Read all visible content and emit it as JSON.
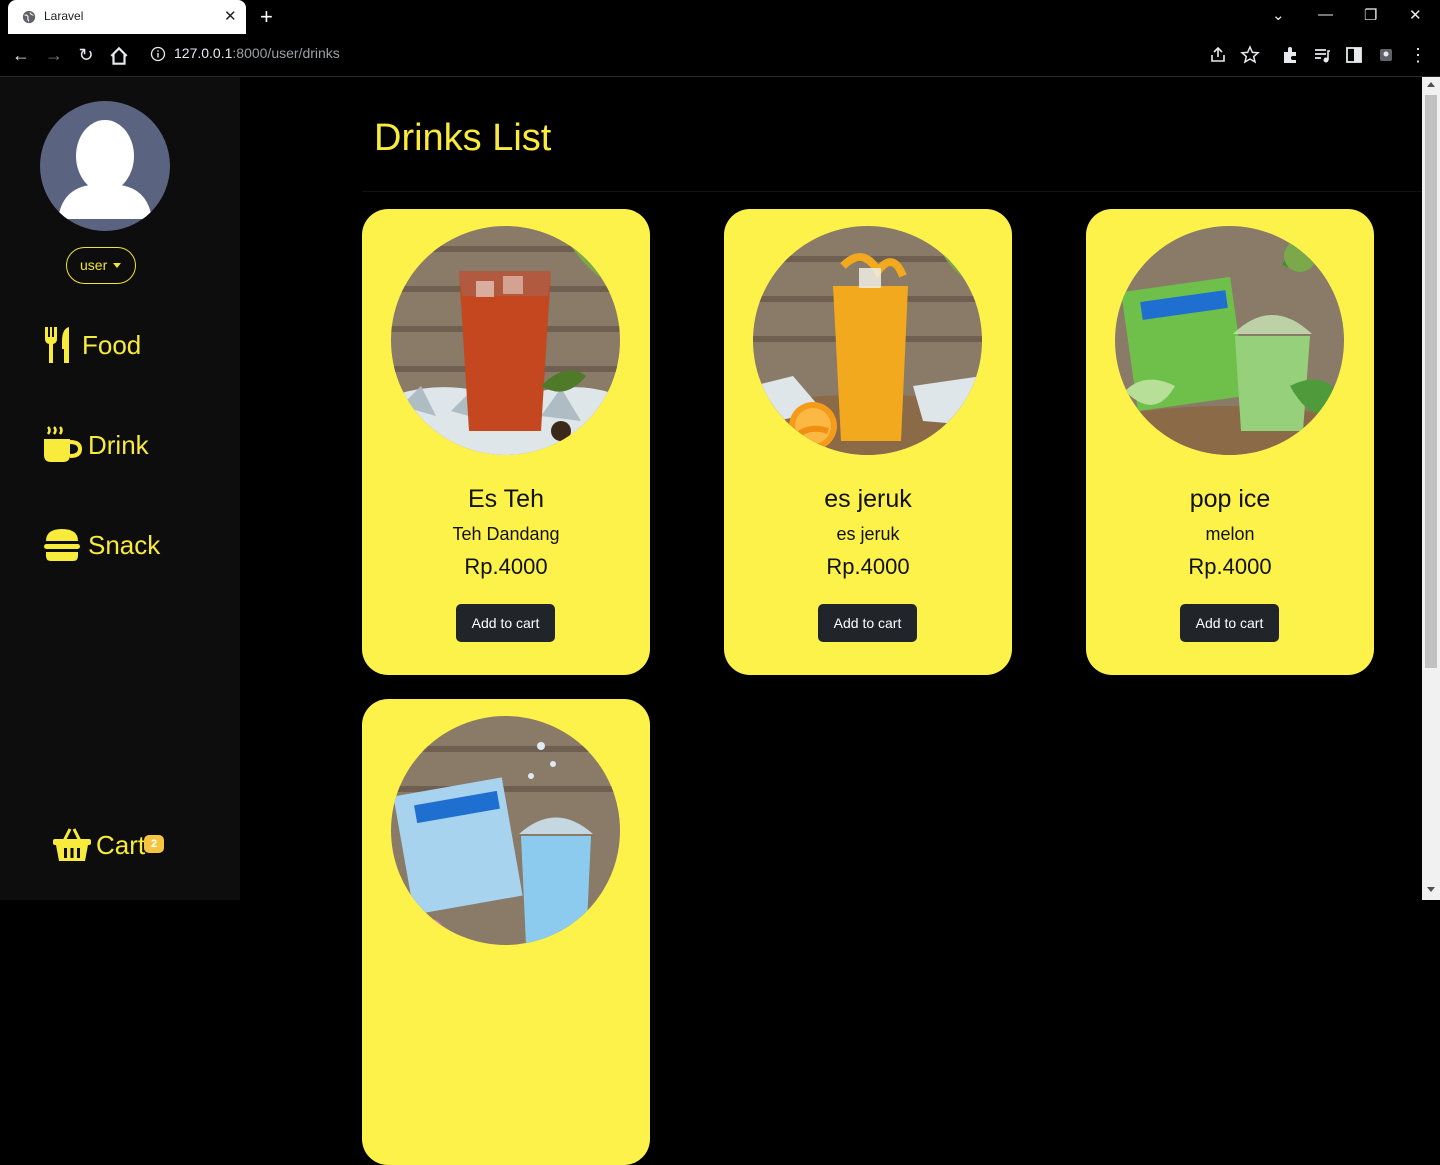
{
  "browser": {
    "tab_title": "Laravel",
    "url_host": "127.0.0.1",
    "url_path": ":8000/user/drinks"
  },
  "sidebar": {
    "user_label": "user",
    "nav": [
      {
        "label": "Food",
        "icon": "utensils-icon"
      },
      {
        "label": "Drink",
        "icon": "mug-hot-icon"
      },
      {
        "label": "Snack",
        "icon": "burger-icon"
      }
    ],
    "cart_label": "Cart",
    "cart_count": "2"
  },
  "main": {
    "title": "Drinks List",
    "drinks": [
      {
        "name": "Es Teh",
        "desc": "Teh Dandang",
        "price": "Rp.4000",
        "button": "Add to cart"
      },
      {
        "name": "es jeruk",
        "desc": "es jeruk",
        "price": "Rp.4000",
        "button": "Add to cart"
      },
      {
        "name": "pop ice",
        "desc": "melon",
        "price": "Rp.4000",
        "button": "Add to cart"
      },
      {
        "name": "",
        "desc": "",
        "price": "",
        "button": ""
      }
    ]
  },
  "colors": {
    "accent": "#f8eb3b",
    "card": "#fdf24a",
    "sidebar": "#0d0d0e",
    "button": "#212529"
  }
}
